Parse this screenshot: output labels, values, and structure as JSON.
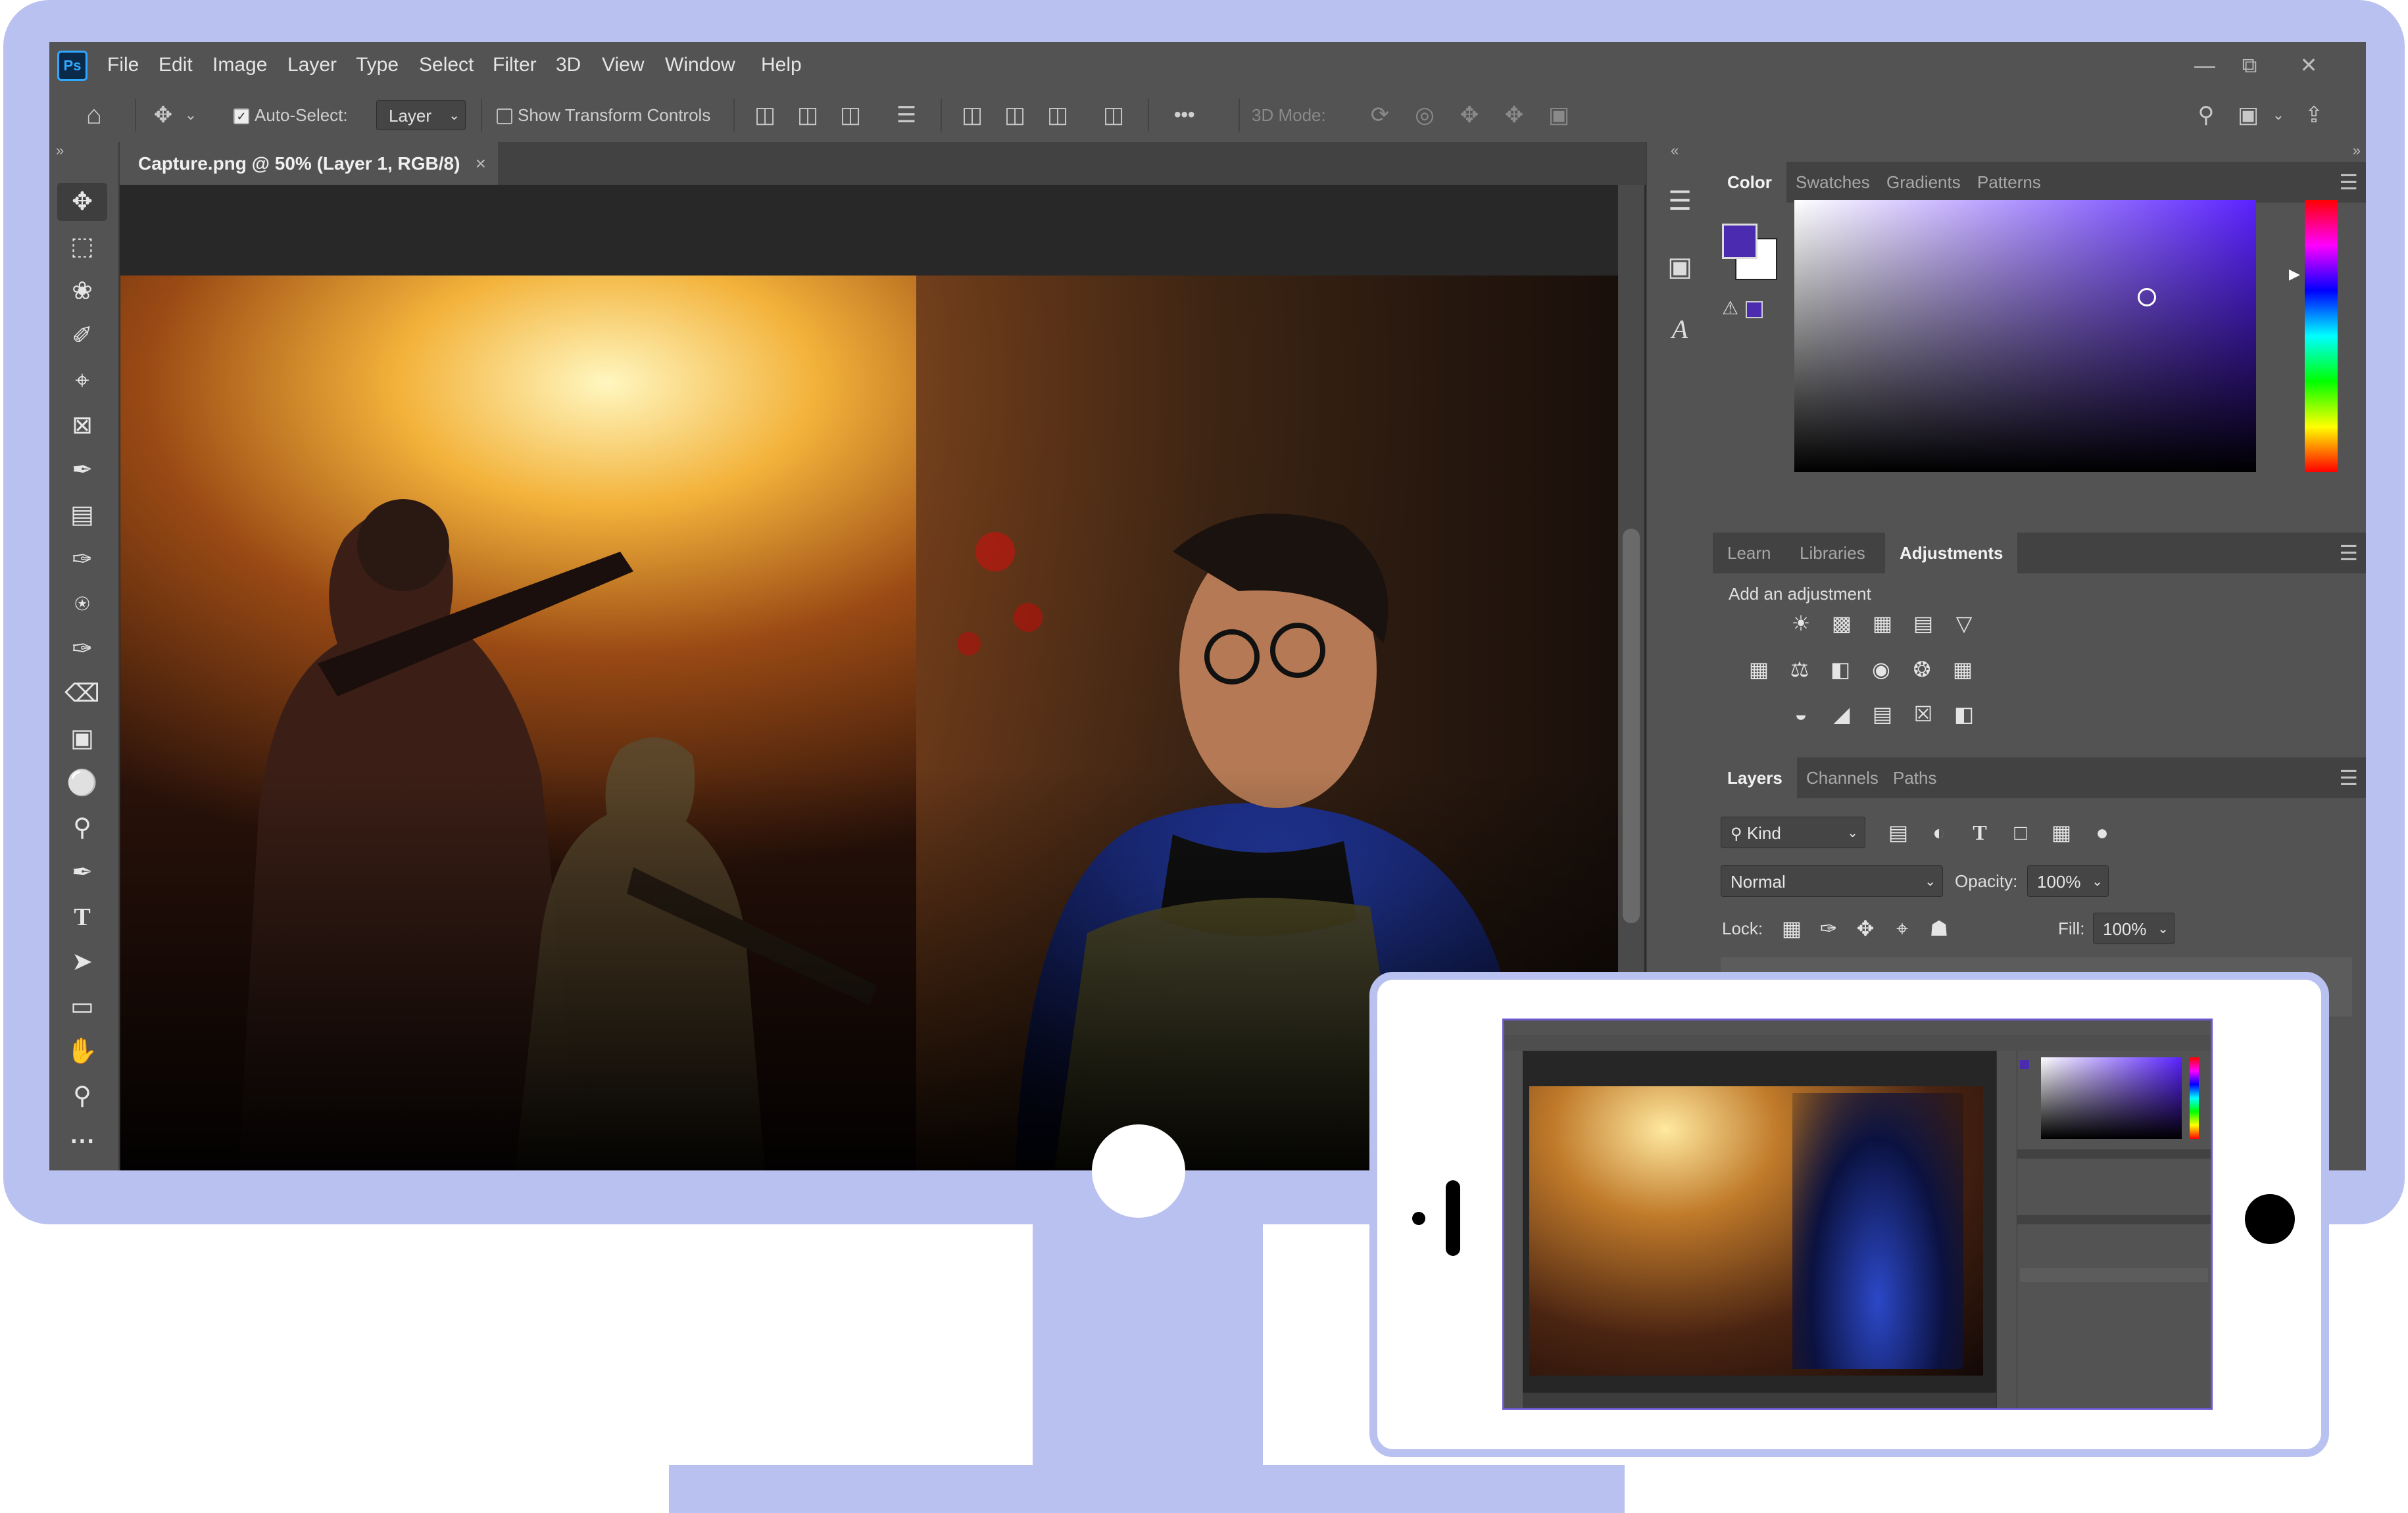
{
  "app": {
    "logo": "Ps",
    "menu": [
      "File",
      "Edit",
      "Image",
      "Layer",
      "Type",
      "Select",
      "Filter",
      "3D",
      "View",
      "Window",
      "Help"
    ],
    "window_controls": [
      "minimize-icon",
      "restore-icon",
      "close-icon"
    ]
  },
  "options_bar": {
    "auto_select_label": "Auto-Select:",
    "auto_select_checked": true,
    "auto_select_target": "Layer",
    "show_transform_label": "Show Transform Controls",
    "show_transform_checked": false,
    "mode_3d_label": "3D Mode:",
    "more_label": "•••"
  },
  "document": {
    "tab_title": "Capture.png @ 50% (Layer 1, RGB/8)",
    "close_glyph": "×"
  },
  "tools": [
    "move-tool",
    "marquee-tool",
    "lasso-tool",
    "quick-selection-tool",
    "crop-tool",
    "frame-tool",
    "eyedropper-tool",
    "healing-brush-tool",
    "brush-tool",
    "clone-stamp-tool",
    "history-brush-tool",
    "eraser-tool",
    "gradient-tool",
    "blur-tool",
    "dodge-tool",
    "pen-tool",
    "type-tool",
    "path-selection-tool",
    "rectangle-tool",
    "hand-tool",
    "zoom-tool",
    "more-tools"
  ],
  "color_panel": {
    "tabs": [
      "Color",
      "Swatches",
      "Gradients",
      "Patterns"
    ],
    "active_tab": "Color",
    "foreground": "#4b2bb0",
    "background": "#ffffff",
    "picker_hue": "#6a3cff"
  },
  "adjustments_panel": {
    "tabs": [
      "Learn",
      "Libraries",
      "Adjustments"
    ],
    "active_tab": "Adjustments",
    "hint": "Add an adjustment"
  },
  "layers_panel": {
    "tabs": [
      "Layers",
      "Channels",
      "Paths"
    ],
    "active_tab": "Layers",
    "filter_label": "Kind",
    "blend_mode": "Normal",
    "opacity_label": "Opacity:",
    "opacity_value": "100%",
    "lock_label": "Lock:",
    "fill_label": "Fill:",
    "fill_value": "100%"
  }
}
